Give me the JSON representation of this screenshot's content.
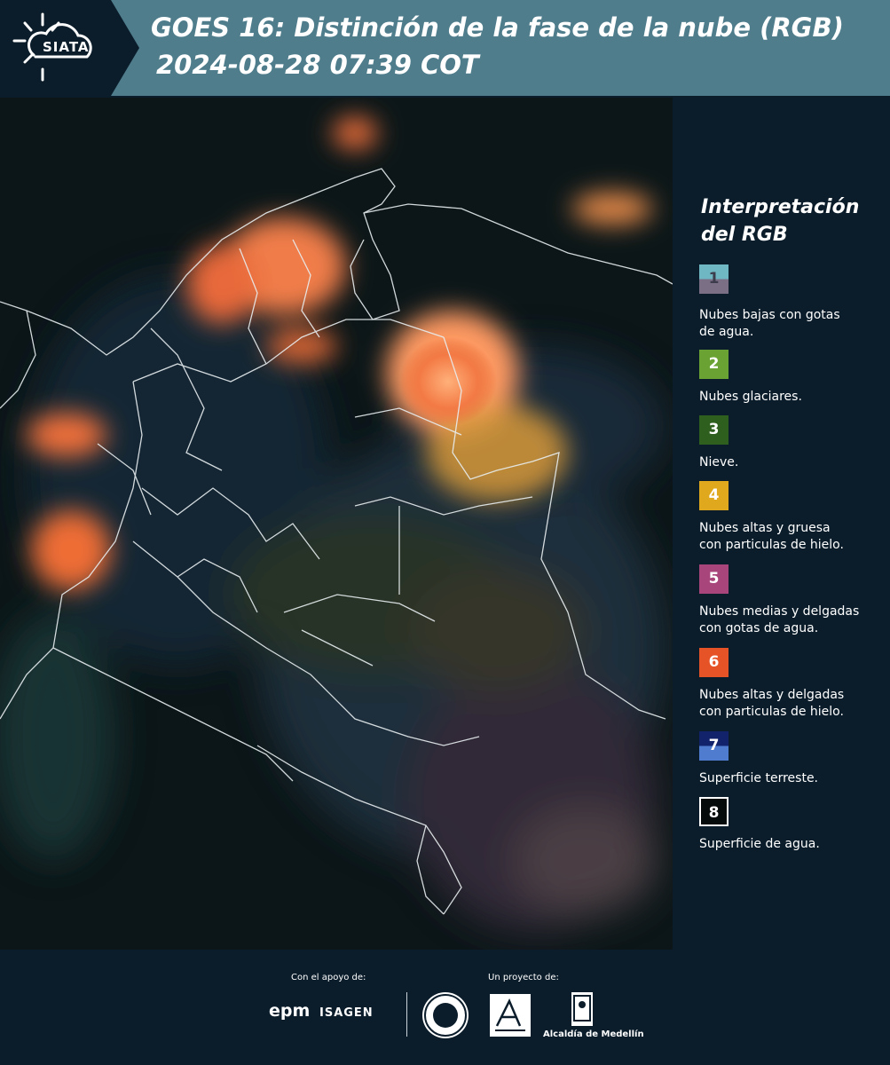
{
  "header": {
    "logo": "SIATA",
    "title_line1": "GOES 16: Distinción de la fase de la nube (RGB)",
    "title_line2": "2024-08-28 07:39 COT"
  },
  "legend": {
    "title_line1": "Interpretación",
    "title_line2": "del RGB",
    "items": [
      {
        "number": "1",
        "label_line1": "Nubes bajas con gotas",
        "label_line2": "de agua.",
        "color_top": "#6fb7c2",
        "color_bottom": "#7b6f86",
        "text_color": "#3c3c4c"
      },
      {
        "number": "2",
        "label_line1": "Nubes glaciares.",
        "label_line2": "",
        "color_top": "#6aa333",
        "color_bottom": "#6aa333",
        "text_color": "#ffffff"
      },
      {
        "number": "3",
        "label_line1": "Nieve.",
        "label_line2": "",
        "color_top": "#2f5f1f",
        "color_bottom": "#2f5f1f",
        "text_color": "#ffffff"
      },
      {
        "number": "4",
        "label_line1": "Nubes altas y gruesa",
        "label_line2": "con particulas de hielo.",
        "color_top": "#e0a81c",
        "color_bottom": "#e0a81c",
        "text_color": "#ffffff"
      },
      {
        "number": "5",
        "label_line1": "Nubes medias y delgadas",
        "label_line2": "con gotas de agua.",
        "color_top": "#a8457a",
        "color_bottom": "#a8457a",
        "text_color": "#ffffff"
      },
      {
        "number": "6",
        "label_line1": "Nubes altas y delgadas",
        "label_line2": "con particulas de hielo.",
        "color_top": "#e55327",
        "color_bottom": "#e55327",
        "text_color": "#ffffff"
      },
      {
        "number": "7",
        "label_line1": "Superficie terreste.",
        "label_line2": "",
        "color_top": "#12236b",
        "color_bottom": "#4f7ccf",
        "text_color": "#ffffff"
      },
      {
        "number": "8",
        "label_line1": "Superficie de agua.",
        "label_line2": "",
        "color_top": "#050b0a",
        "color_bottom": "#050b0a",
        "text_color": "#ffffff"
      }
    ]
  },
  "footer": {
    "support_label": "Con el apoyo de:",
    "project_label": "Un proyecto de:",
    "sponsor1": "epm",
    "sponsor2": "ISAGEN",
    "partner3": "Alcaldía de Medellín"
  }
}
